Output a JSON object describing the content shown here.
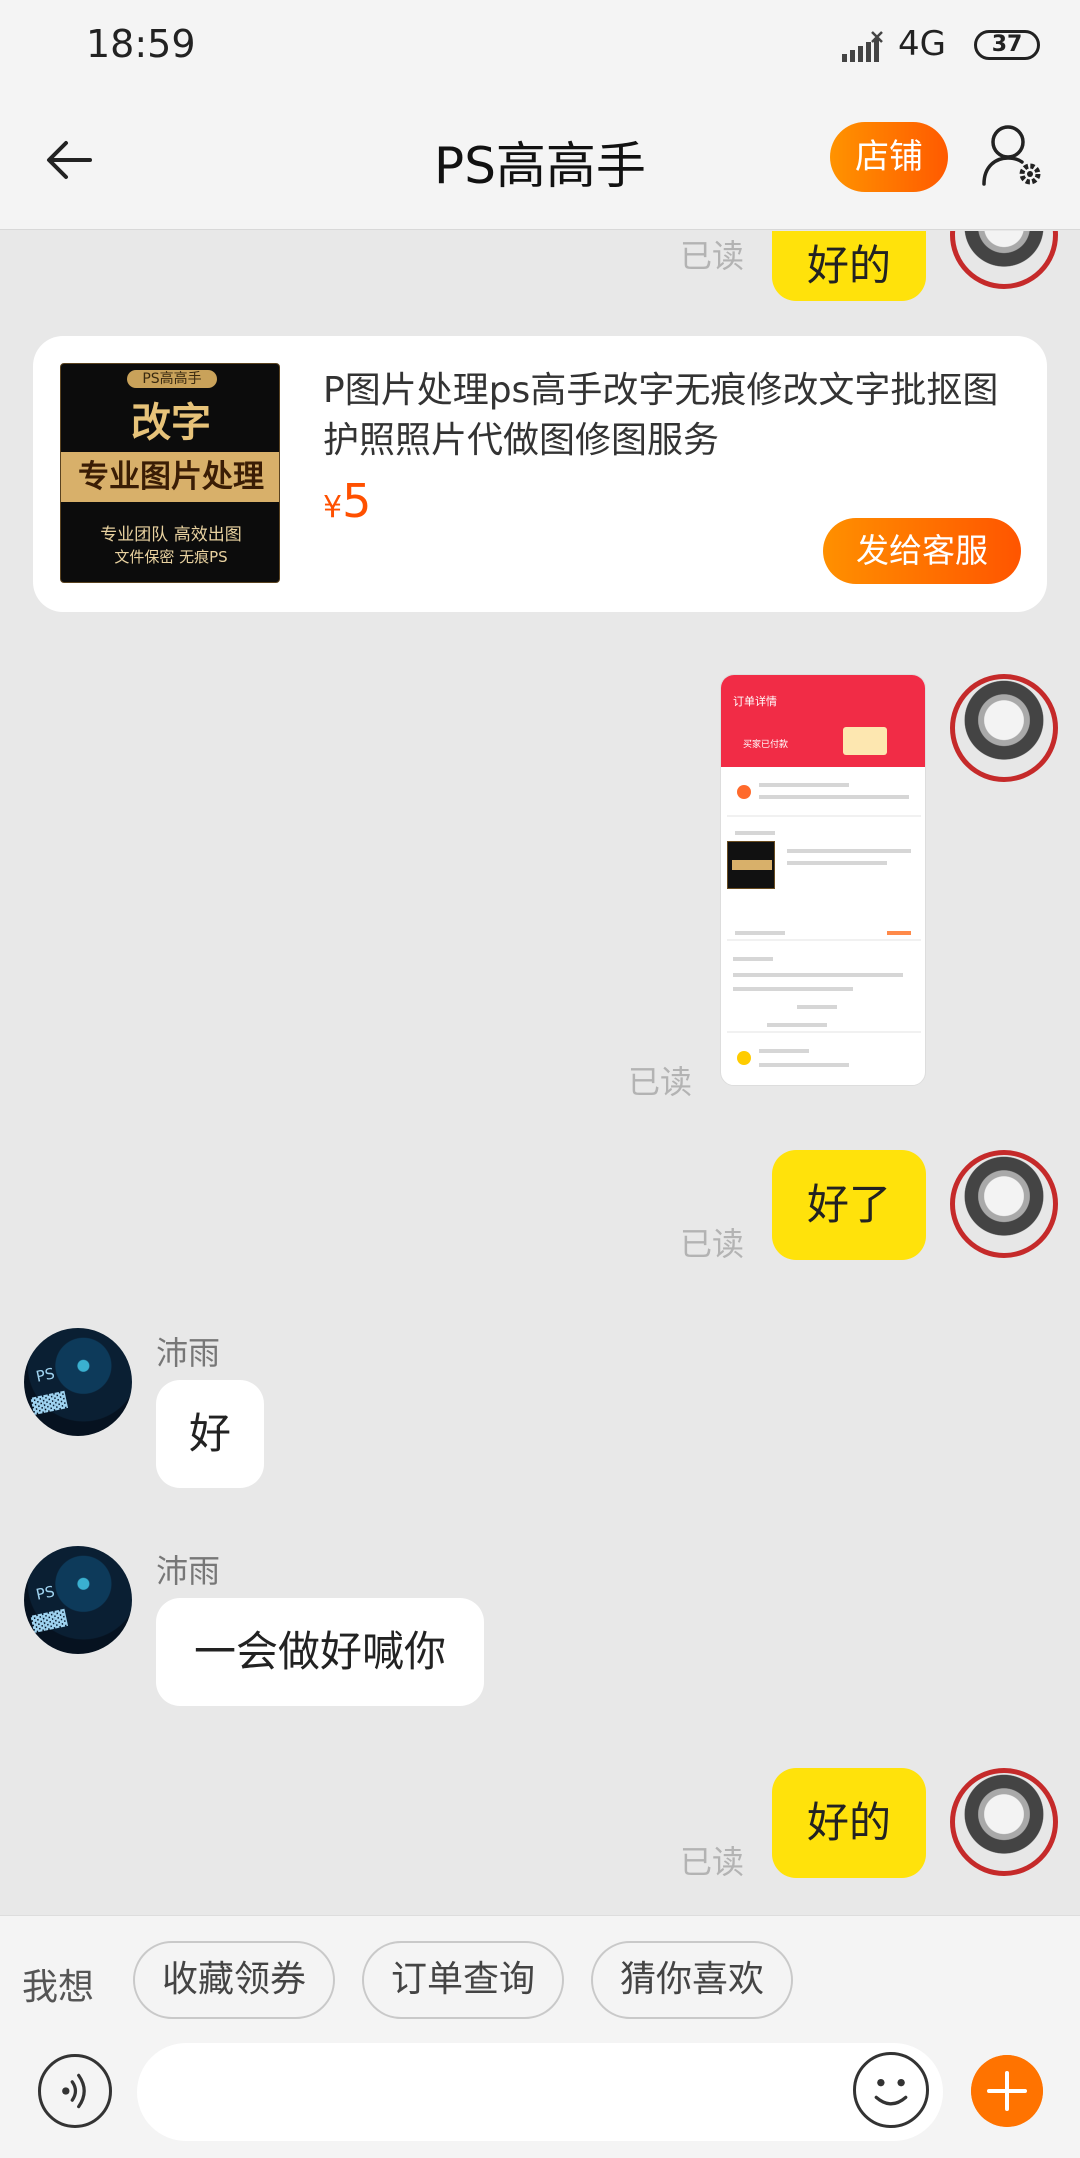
{
  "status_bar": {
    "time": "18:59",
    "network": "4G",
    "battery": "37"
  },
  "header": {
    "title": "PS高高手",
    "shop_button": "店铺",
    "back_icon": "arrow-left-icon",
    "settings_icon": "user-settings-icon"
  },
  "chat": {
    "read_label": "已读",
    "top_partial_message": "好的",
    "product_card": {
      "image": {
        "tag": "PS高高手",
        "headline": "改字",
        "band": "专业图片处理",
        "line1": "专业团队 高效出图",
        "line2": "文件保密 无痕PS"
      },
      "title": "P图片处理ps高手改字无痕修改文字批抠图护照照片代做图修图服务",
      "currency": "¥",
      "price": "5",
      "send_button": "发给客服"
    },
    "screenshot_message": {
      "header_title": "订单详情",
      "status_text": "买家已付款"
    },
    "messages": [
      {
        "from": "me",
        "text": "好了"
      },
      {
        "from": "other",
        "sender": "沛雨",
        "text": "好"
      },
      {
        "from": "other",
        "sender": "沛雨",
        "text": "一会做好喊你"
      },
      {
        "from": "me",
        "text": "好的"
      }
    ]
  },
  "bottom_bar": {
    "want_label": "我想",
    "chips": [
      "收藏领券",
      "订单查询",
      "猜你喜欢"
    ],
    "input_placeholder": "",
    "voice_icon": "voice-icon",
    "emoji_icon": "emoji-icon",
    "plus_icon": "plus-icon"
  },
  "colors": {
    "accent_orange": "#ff6a00",
    "my_bubble": "#ffe20b",
    "price": "#ff5000",
    "background": "#e8e8e8"
  }
}
